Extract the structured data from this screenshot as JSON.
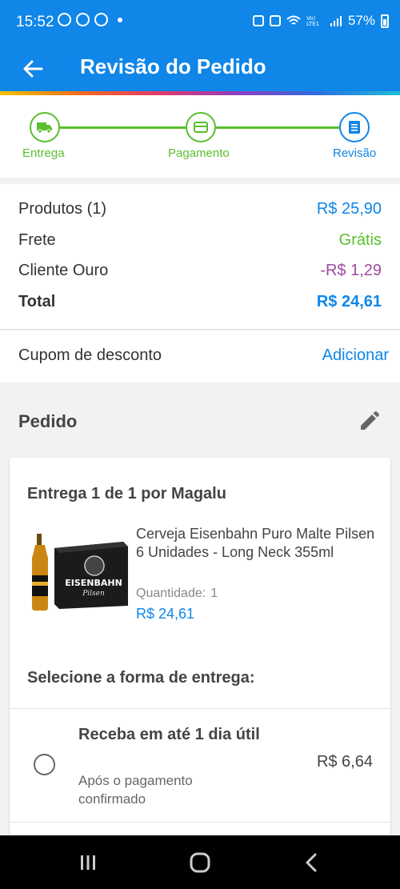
{
  "status_bar": {
    "time": "15:52",
    "battery": "57%",
    "left_icons": [
      "whatsapp-icon",
      "dnd-icon",
      "x-app-icon",
      "notification-dot-icon"
    ],
    "right_icons": [
      "alarm-icon",
      "mute-icon",
      "wifi-icon",
      "volte-icon",
      "signal-icon",
      "battery-icon"
    ]
  },
  "app_bar": {
    "title": "Revisão do Pedido",
    "back_icon": "arrow-left-icon"
  },
  "stepper": {
    "steps": [
      {
        "label": "Entrega",
        "icon": "truck-icon",
        "state": "done"
      },
      {
        "label": "Pagamento",
        "icon": "card-icon",
        "state": "done"
      },
      {
        "label": "Revisão",
        "icon": "document-icon",
        "state": "active"
      }
    ]
  },
  "summary": {
    "rows": [
      {
        "label": "Produtos (1)",
        "value": "R$ 25,90"
      },
      {
        "label": "Frete",
        "value": "Grátis"
      },
      {
        "label": "Cliente Ouro",
        "value": "-R$ 1,29"
      },
      {
        "label": "Total",
        "value": "R$ 24,61"
      }
    ]
  },
  "coupon": {
    "label": "Cupom de desconto",
    "action": "Adicionar"
  },
  "order": {
    "title": "Pedido",
    "edit_icon": "pencil-icon",
    "delivery_title": "Entrega 1 de 1 por Magalu",
    "product": {
      "name": "Cerveja Eisenbahn Puro Malte Pilsen 6 Unidades - Long Neck 355ml",
      "quantity_label": "Quantidade:",
      "quantity": "1",
      "price": "R$ 24,61",
      "image_label": "EISENBAHN",
      "image_sub": "Pilsen"
    },
    "shipping_title": "Selecione a forma de entrega:",
    "shipping_option": {
      "title": "Receba em até 1 dia útil",
      "subtitle": "Após o pagamento confirmado",
      "price": "R$ 6,64"
    }
  },
  "nav_bar": {
    "icons": [
      "recent-apps-icon",
      "home-icon",
      "back-icon"
    ]
  },
  "colors": {
    "primary": "#0f86e8",
    "green": "#5bbe2f",
    "purple": "#9d4ca0"
  }
}
